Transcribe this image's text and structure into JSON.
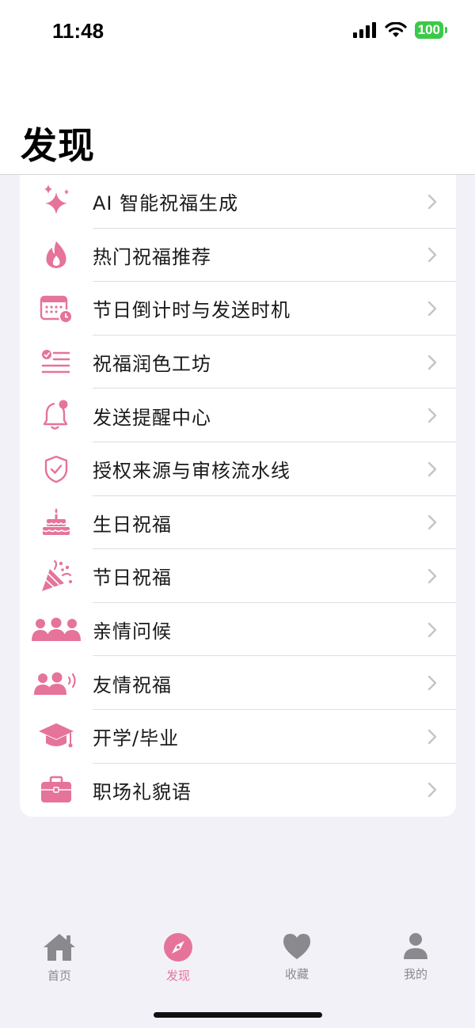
{
  "status_bar": {
    "time": "11:48",
    "battery": "100"
  },
  "header": {
    "title": "发现"
  },
  "colors": {
    "accent": "#e5739a",
    "tab_inactive": "#8a8a8e",
    "battery": "#3cc94a"
  },
  "menu": {
    "items": [
      {
        "label": "AI 智能祝福生成",
        "icon": "sparkles-icon"
      },
      {
        "label": "热门祝福推荐",
        "icon": "flame-icon"
      },
      {
        "label": "节日倒计时与发送时机",
        "icon": "calendar-clock-icon"
      },
      {
        "label": "祝福润色工坊",
        "icon": "checklist-icon"
      },
      {
        "label": "发送提醒中心",
        "icon": "bell-badge-icon"
      },
      {
        "label": "授权来源与审核流水线",
        "icon": "shield-check-icon"
      },
      {
        "label": "生日祝福",
        "icon": "birthday-cake-icon"
      },
      {
        "label": "节日祝福",
        "icon": "party-popper-icon"
      },
      {
        "label": "亲情问候",
        "icon": "family-group-icon"
      },
      {
        "label": "友情祝福",
        "icon": "friends-wave-icon"
      },
      {
        "label": "开学/毕业",
        "icon": "graduation-cap-icon"
      },
      {
        "label": "职场礼貌语",
        "icon": "briefcase-icon"
      }
    ]
  },
  "tabs": [
    {
      "label": "首页",
      "icon": "house-icon",
      "active": false
    },
    {
      "label": "发现",
      "icon": "compass-icon",
      "active": true
    },
    {
      "label": "收藏",
      "icon": "heart-icon",
      "active": false
    },
    {
      "label": "我的",
      "icon": "person-icon",
      "active": false
    }
  ]
}
